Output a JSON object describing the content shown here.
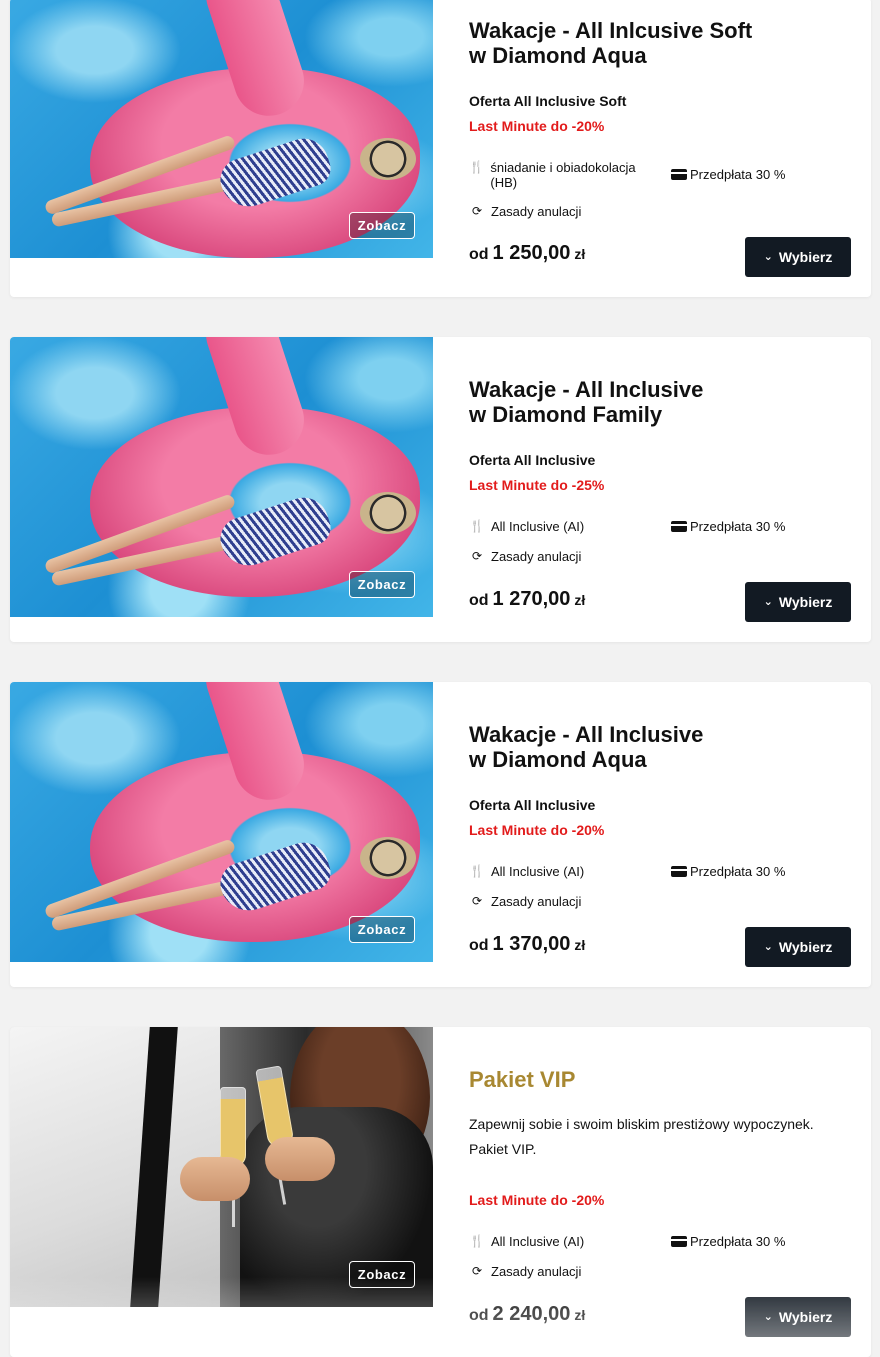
{
  "offers": [
    {
      "title_line1": "Wakacje - All Inlcusive Soft",
      "title_line2": "w Diamond Aqua",
      "offer_label": "Oferta All Inclusive Soft",
      "last_minute": "Last Minute do -20%",
      "board_icon": "cutlery-icon",
      "board": "śniadanie i obiadokolacja (HB)",
      "payment_icon": "credit-card-icon",
      "payment": "Przedpłata 30 %",
      "cancel_icon": "refresh-icon",
      "cancel": "Zasady anulacji",
      "price_prefix": "od",
      "price": "1 250,00",
      "currency": "zł",
      "view_label": "Zobacz",
      "select_label": "Wybierz"
    },
    {
      "title_line1": "Wakacje - All Inclusive",
      "title_line2": "w Diamond Family",
      "offer_label": "Oferta All Inclusive",
      "last_minute": "Last Minute do -25%",
      "board_icon": "cutlery-icon",
      "board": "All Inclusive (AI)",
      "payment_icon": "credit-card-icon",
      "payment": "Przedpłata 30 %",
      "cancel_icon": "refresh-icon",
      "cancel": "Zasady anulacji",
      "price_prefix": "od",
      "price": "1 270,00",
      "currency": "zł",
      "view_label": "Zobacz",
      "select_label": "Wybierz"
    },
    {
      "title_line1": "Wakacje - All Inclusive",
      "title_line2": "w Diamond Aqua",
      "offer_label": "Oferta All Inclusive",
      "last_minute": "Last Minute do -20%",
      "board_icon": "cutlery-icon",
      "board": "All Inclusive (AI)",
      "payment_icon": "credit-card-icon",
      "payment": "Przedpłata 30 %",
      "cancel_icon": "refresh-icon",
      "cancel": "Zasady anulacji",
      "price_prefix": "od",
      "price": "1 370,00",
      "currency": "zł",
      "view_label": "Zobacz",
      "select_label": "Wybierz"
    },
    {
      "title": "Pakiet VIP",
      "description": "Zapewnij sobie i swoim bliskim prestiżowy wypoczynek. Pakiet VIP.",
      "last_minute": "Last Minute do -20%",
      "board_icon": "cutlery-icon",
      "board": "All Inclusive (AI)",
      "payment_icon": "credit-card-icon",
      "payment": "Przedpłata 30 %",
      "cancel_icon": "refresh-icon",
      "cancel": "Zasady anulacji",
      "price_prefix": "od",
      "price": "2 240,00",
      "currency": "zł",
      "view_label": "Zobacz",
      "select_label": "Wybierz"
    }
  ],
  "colors": {
    "last_minute": "#e21b1b",
    "vip_title": "#a88832",
    "button_bg": "#121a23",
    "page_bg": "#f2f2f2"
  }
}
